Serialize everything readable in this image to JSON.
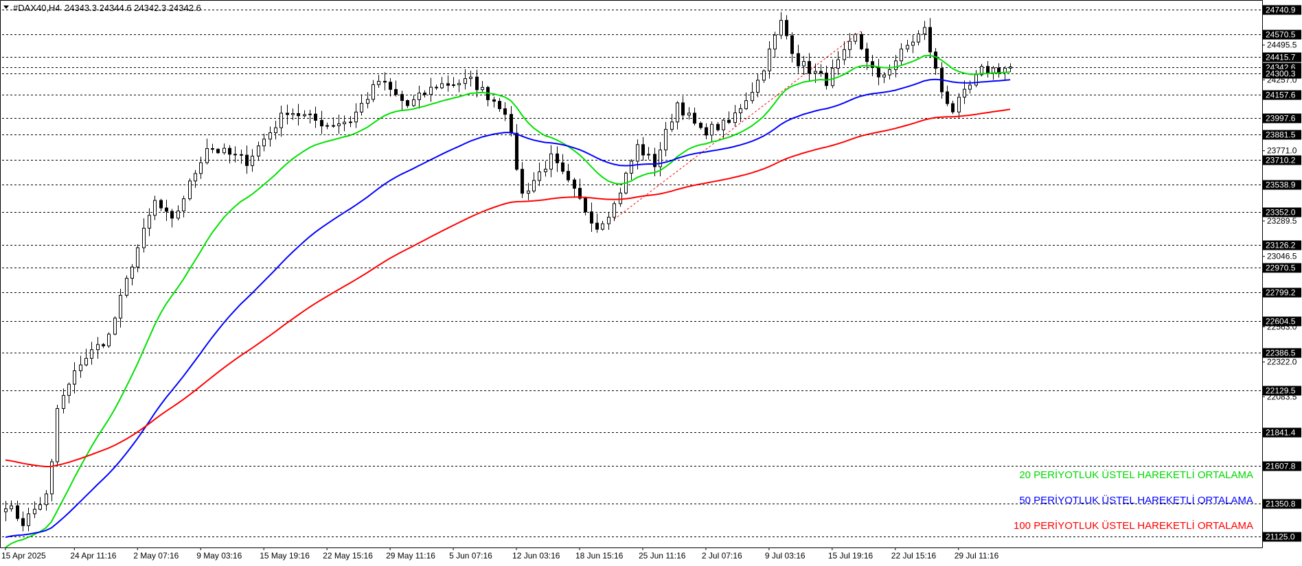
{
  "header": {
    "symbol": "#DAX40,H4",
    "ohlc": "24343.3 24344.6 24342.3 24342.6"
  },
  "colors": {
    "background": "#ffffff",
    "candle": "#000000",
    "ema20": "#00e000",
    "ema50": "#0000ff",
    "ema100": "#ff0000",
    "trendline": "#ff0000",
    "level_line": "#000000",
    "label_bg": "#000000"
  },
  "legend": [
    {
      "text": "20 PERİYOTLUK ÜSTEL HAREKETLİ ORTALAMA",
      "color": "#00d800"
    },
    {
      "text": "50 PERİYOTLUK ÜSTEL HAREKETLİ ORTALAMA",
      "color": "#0000ff"
    },
    {
      "text": "100 PERİYOTLUK ÜSTEL HAREKETLİ ORTALAMA",
      "color": "#ff0000"
    }
  ],
  "chart_data": {
    "type": "candlestick",
    "ylim": [
      21050,
      24800
    ],
    "bar_count": 176,
    "x_tick_labels": [
      {
        "bar": 0,
        "label": "15 Apr 2025"
      },
      {
        "bar": 12,
        "label": "24 Apr 11:16"
      },
      {
        "bar": 23,
        "label": "2 May 07:16"
      },
      {
        "bar": 34,
        "label": "9 May 03:16"
      },
      {
        "bar": 45,
        "label": "15 May 19:16"
      },
      {
        "bar": 56,
        "label": "22 May 15:16"
      },
      {
        "bar": 67,
        "label": "29 May 11:16"
      },
      {
        "bar": 78,
        "label": "5 Jun 07:16"
      },
      {
        "bar": 89,
        "label": "12 Jun 03:16"
      },
      {
        "bar": 100,
        "label": "18 Jun 15:16"
      },
      {
        "bar": 111,
        "label": "25 Jun 11:16"
      },
      {
        "bar": 122,
        "label": "2 Jul 07:16"
      },
      {
        "bar": 133,
        "label": "9 Jul 03:16"
      },
      {
        "bar": 144,
        "label": "15 Jul 19:16"
      },
      {
        "bar": 155,
        "label": "22 Jul 15:16"
      },
      {
        "bar": 166,
        "label": "29 Jul 11:16"
      }
    ],
    "y_tick_labels": [
      24495.5,
      24257.0,
      23771.0,
      23289.5,
      23046.5,
      22563.0,
      22322.0,
      22083.5
    ],
    "levels": [
      24740.9,
      24570.5,
      24415.7,
      24342.6,
      24300.3,
      24157.6,
      23997.6,
      23881.5,
      23710.2,
      23538.9,
      23352.0,
      23126.2,
      22970.5,
      22799.2,
      22604.5,
      22386.5,
      22129.5,
      21841.4,
      21607.8,
      21350.8,
      21125.0
    ],
    "trendline": {
      "from": {
        "bar": 106,
        "price": 23300
      },
      "to": {
        "bar": 149,
        "price": 24590
      }
    },
    "anchors": [
      [
        0,
        21350
      ],
      [
        3,
        21220
      ],
      [
        7,
        21400
      ],
      [
        8,
        21620
      ],
      [
        9,
        22000
      ],
      [
        13,
        22320
      ],
      [
        18,
        22500
      ],
      [
        22,
        23000
      ],
      [
        26,
        23420
      ],
      [
        29,
        23280
      ],
      [
        35,
        23800
      ],
      [
        42,
        23700
      ],
      [
        49,
        24050
      ],
      [
        56,
        23950
      ],
      [
        60,
        23980
      ],
      [
        65,
        24250
      ],
      [
        70,
        24080
      ],
      [
        75,
        24220
      ],
      [
        81,
        24250
      ],
      [
        87,
        24050
      ],
      [
        90,
        23470
      ],
      [
        95,
        23720
      ],
      [
        103,
        23250
      ],
      [
        106,
        23400
      ],
      [
        110,
        23800
      ],
      [
        113,
        23680
      ],
      [
        117,
        24100
      ],
      [
        121,
        23900
      ],
      [
        126,
        23960
      ],
      [
        131,
        24250
      ],
      [
        135,
        24650
      ],
      [
        138,
        24380
      ],
      [
        143,
        24250
      ],
      [
        148,
        24550
      ],
      [
        152,
        24250
      ],
      [
        157,
        24490
      ],
      [
        160,
        24600
      ],
      [
        163,
        24180
      ],
      [
        165,
        24050
      ],
      [
        170,
        24320
      ],
      [
        175,
        24342
      ]
    ],
    "series": [
      {
        "name": "20 PERİYOTLUK ÜSTEL HAREKETLİ ORTALAMA",
        "period": 20
      },
      {
        "name": "50 PERİYOTLUK ÜSTEL HAREKETLİ ORTALAMA",
        "period": 50
      },
      {
        "name": "100 PERİYOTLUK ÜSTEL HAREKETLİ ORTALAMA",
        "period": 100
      }
    ]
  }
}
